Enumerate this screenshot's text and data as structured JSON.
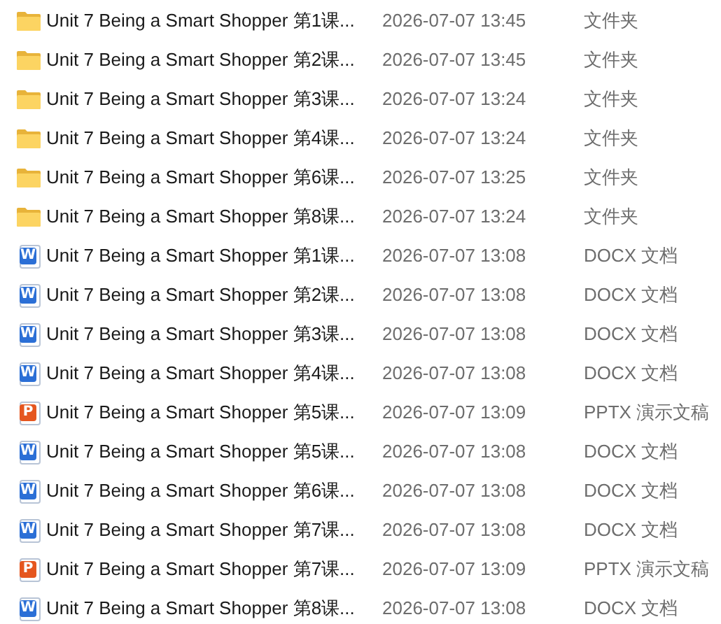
{
  "files": [
    {
      "kind": "folder",
      "name": "Unit 7 Being a Smart Shopper 第1课...",
      "modified": "2026-07-07 13:45",
      "type": "文件夹"
    },
    {
      "kind": "folder",
      "name": "Unit 7 Being a Smart Shopper 第2课...",
      "modified": "2026-07-07 13:45",
      "type": "文件夹"
    },
    {
      "kind": "folder",
      "name": "Unit 7 Being a Smart Shopper 第3课...",
      "modified": "2026-07-07 13:24",
      "type": "文件夹"
    },
    {
      "kind": "folder",
      "name": "Unit 7 Being a Smart Shopper 第4课...",
      "modified": "2026-07-07 13:24",
      "type": "文件夹"
    },
    {
      "kind": "folder",
      "name": "Unit 7 Being a Smart Shopper 第6课...",
      "modified": "2026-07-07 13:25",
      "type": "文件夹"
    },
    {
      "kind": "folder",
      "name": "Unit 7 Being a Smart Shopper 第8课...",
      "modified": "2026-07-07 13:24",
      "type": "文件夹"
    },
    {
      "kind": "docx",
      "icon_text": "W",
      "name": "Unit 7 Being a Smart Shopper 第1课...",
      "modified": "2026-07-07 13:08",
      "type": "DOCX 文档"
    },
    {
      "kind": "docx",
      "icon_text": "W",
      "name": "Unit 7 Being a Smart Shopper 第2课...",
      "modified": "2026-07-07 13:08",
      "type": "DOCX 文档"
    },
    {
      "kind": "docx",
      "icon_text": "W",
      "name": "Unit 7 Being a Smart Shopper 第3课...",
      "modified": "2026-07-07 13:08",
      "type": "DOCX 文档"
    },
    {
      "kind": "docx",
      "icon_text": "W",
      "name": "Unit 7 Being a Smart Shopper 第4课...",
      "modified": "2026-07-07 13:08",
      "type": "DOCX 文档"
    },
    {
      "kind": "pptx",
      "icon_text": "P",
      "name": "Unit 7 Being a Smart Shopper 第5课...",
      "modified": "2026-07-07 13:09",
      "type": "PPTX 演示文稿"
    },
    {
      "kind": "docx",
      "icon_text": "W",
      "name": "Unit 7 Being a Smart Shopper 第5课...",
      "modified": "2026-07-07 13:08",
      "type": "DOCX 文档"
    },
    {
      "kind": "docx",
      "icon_text": "W",
      "name": "Unit 7 Being a Smart Shopper 第6课...",
      "modified": "2026-07-07 13:08",
      "type": "DOCX 文档"
    },
    {
      "kind": "docx",
      "icon_text": "W",
      "name": "Unit 7 Being a Smart Shopper 第7课...",
      "modified": "2026-07-07 13:08",
      "type": "DOCX 文档"
    },
    {
      "kind": "pptx",
      "icon_text": "P",
      "name": "Unit 7 Being a Smart Shopper 第7课...",
      "modified": "2026-07-07 13:09",
      "type": "PPTX 演示文稿"
    },
    {
      "kind": "docx",
      "icon_text": "W",
      "name": "Unit 7 Being a Smart Shopper 第8课...",
      "modified": "2026-07-07 13:08",
      "type": "DOCX 文档"
    }
  ]
}
